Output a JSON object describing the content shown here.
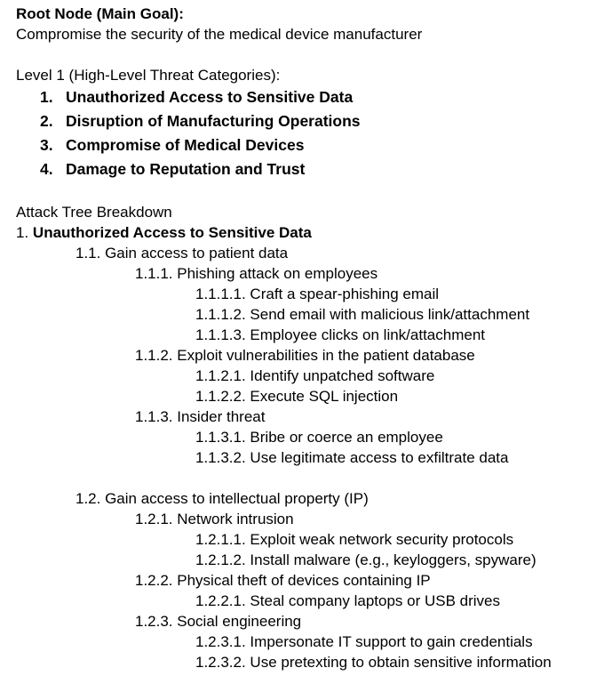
{
  "root": {
    "heading": "Root Node (Main Goal):",
    "goal": "Compromise the security of the medical device manufacturer"
  },
  "level1": {
    "heading": "Level 1 (High-Level Threat Categories):",
    "items": [
      {
        "num": "1.",
        "label": "Unauthorized Access to Sensitive Data"
      },
      {
        "num": "2.",
        "label": "Disruption of Manufacturing Operations"
      },
      {
        "num": "3.",
        "label": "Compromise of Medical Devices"
      },
      {
        "num": "4.",
        "label": "Damage to Reputation and Trust"
      }
    ]
  },
  "breakdown": {
    "heading": "Attack Tree Breakdown",
    "section1": {
      "num": "1.",
      "title": "Unauthorized Access to Sensitive Data"
    },
    "lines": [
      "1.1. Gain access to patient data",
      "1.1.1. Phishing attack on employees",
      "1.1.1.1. Craft a spear-phishing email",
      "1.1.1.2. Send email with malicious link/attachment",
      "1.1.1.3. Employee clicks on link/attachment",
      "1.1.2. Exploit vulnerabilities in the patient database",
      "1.1.2.1. Identify unpatched software",
      "1.1.2.2. Execute SQL injection",
      "1.1.3. Insider threat",
      "1.1.3.1. Bribe or coerce an employee",
      "1.1.3.2. Use legitimate access to exfiltrate data",
      "1.2. Gain access to intellectual property (IP)",
      "1.2.1. Network intrusion",
      "1.2.1.1. Exploit weak network security protocols",
      "1.2.1.2. Install malware (e.g., keyloggers, spyware)",
      "1.2.2. Physical theft of devices containing IP",
      "1.2.2.1. Steal company laptops or USB drives",
      "1.2.3. Social engineering",
      "1.2.3.1. Impersonate IT support to gain credentials",
      "1.2.3.2. Use pretexting to obtain sensitive information"
    ]
  }
}
